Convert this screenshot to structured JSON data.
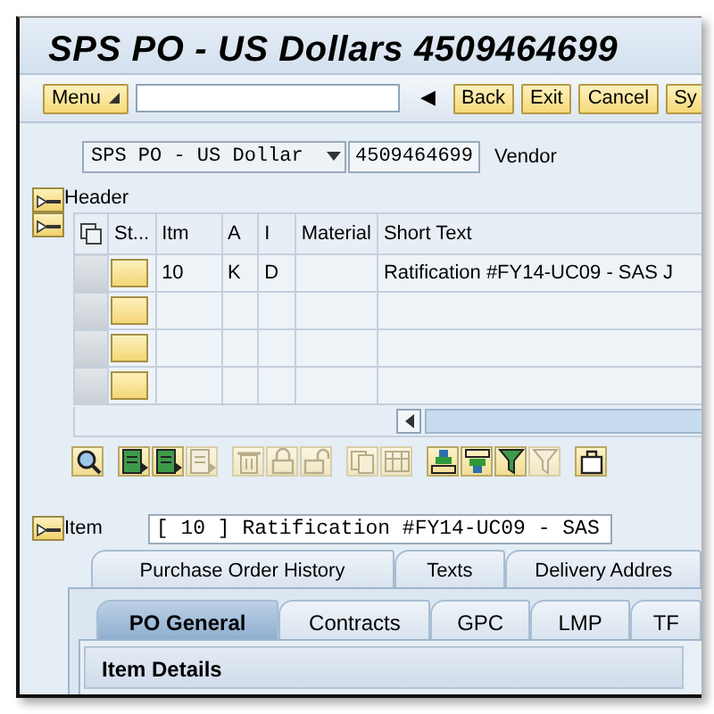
{
  "window": {
    "title": "SPS PO - US Dollars 4509464699"
  },
  "toolbar": {
    "menu_button": "Menu",
    "nav_arrow": "◀",
    "buttons": [
      "Back",
      "Exit",
      "Cancel",
      "Sy"
    ]
  },
  "document": {
    "type_dropdown": "SPS PO - US Dollar",
    "number": "4509464699",
    "vendor_label": "Vendor"
  },
  "header": {
    "label": "Header"
  },
  "items_table": {
    "columns": [
      "St...",
      "Itm",
      "A",
      "I",
      "Material",
      "Short Text"
    ],
    "rows": [
      {
        "itm": "10",
        "a": "K",
        "i": "D",
        "short_text": "Ratification #FY14-UC09 - SAS J"
      },
      {},
      {},
      {}
    ]
  },
  "table_toolbar": [
    [
      {
        "kind": "find",
        "disabled": false
      }
    ],
    [
      {
        "kind": "detail",
        "disabled": false
      },
      {
        "kind": "detail",
        "disabled": false
      },
      {
        "kind": "detail",
        "disabled": true
      }
    ],
    [
      {
        "kind": "delete",
        "disabled": true
      },
      {
        "kind": "lock",
        "disabled": true
      },
      {
        "kind": "unlock",
        "disabled": true
      }
    ],
    [
      {
        "kind": "copy",
        "disabled": true
      },
      {
        "kind": "grid",
        "disabled": true
      }
    ],
    [
      {
        "kind": "sort_up",
        "disabled": false
      },
      {
        "kind": "sort_down",
        "disabled": false
      },
      {
        "kind": "filter",
        "disabled": false
      },
      {
        "kind": "filter",
        "disabled": true
      }
    ],
    [
      {
        "kind": "bag",
        "disabled": false
      }
    ]
  ],
  "item": {
    "label": "Item",
    "selector": "[ 10 ] Ratification #FY14-UC09 - SAS"
  },
  "outer_tabs": [
    {
      "label": "Purchase Order History",
      "selected": false
    },
    {
      "label": "Texts",
      "selected": false
    },
    {
      "label": "Delivery Addres",
      "selected": false
    }
  ],
  "inner_tabs": [
    {
      "label": "PO General",
      "selected": true
    },
    {
      "label": "Contracts",
      "selected": false
    },
    {
      "label": "GPC",
      "selected": false
    },
    {
      "label": "LMP",
      "selected": false
    },
    {
      "label": "TF",
      "selected": false
    }
  ],
  "section": {
    "title": "Item Details"
  }
}
